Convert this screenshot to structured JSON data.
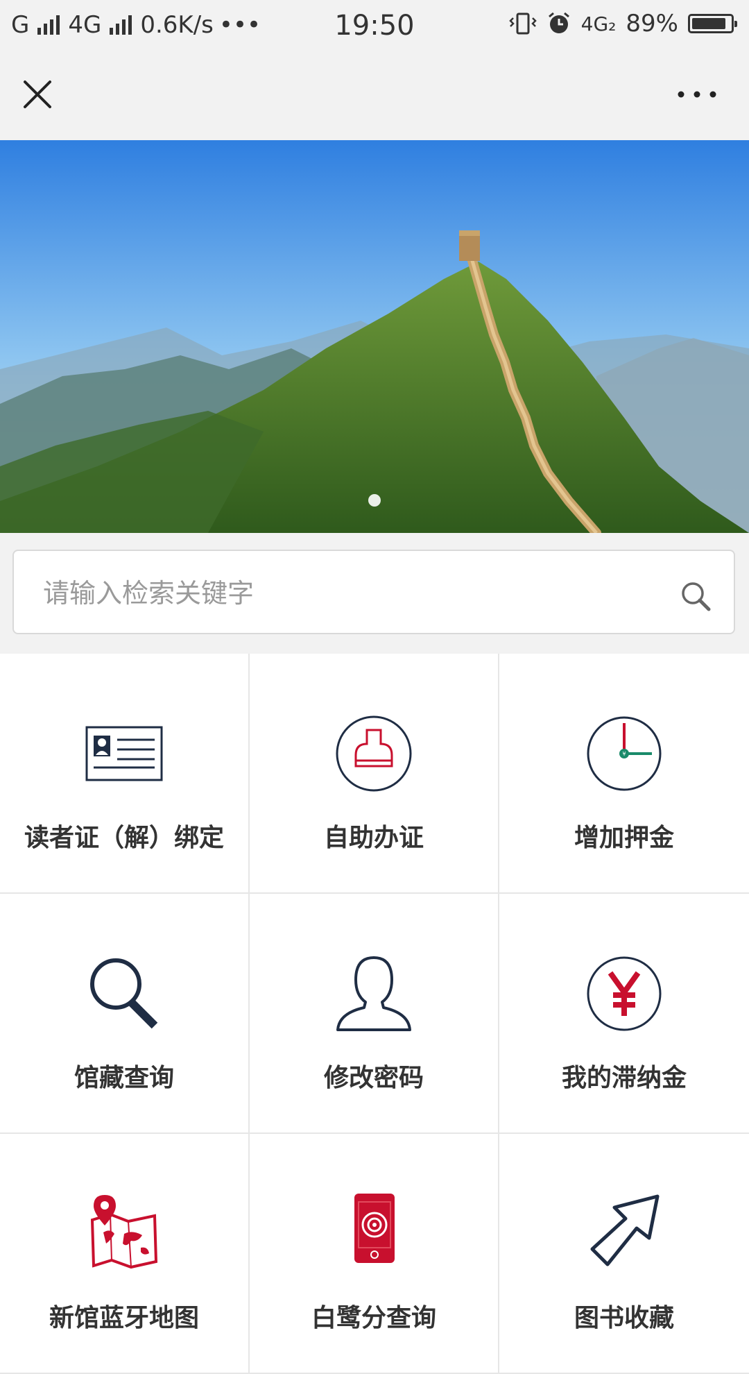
{
  "status_bar": {
    "carrier1": "G",
    "carrier2": "4G",
    "speed": "0.6K/s",
    "dots": "•••",
    "time": "19:50",
    "net_badge": "4G₂",
    "battery_percent": "89%",
    "battery_level": 0.89
  },
  "nav": {
    "close_icon": "close-icon",
    "more_icon": "more-icon"
  },
  "banner": {
    "image": "great-wall-photo",
    "slide_count": 1,
    "active_slide": 1
  },
  "search": {
    "placeholder": "请输入检索关键字",
    "value": ""
  },
  "grid": {
    "items": [
      {
        "label": "读者证（解）绑定",
        "icon": "reader-card-icon"
      },
      {
        "label": "自助办证",
        "icon": "self-service-card-icon"
      },
      {
        "label": "增加押金",
        "icon": "deposit-clock-icon"
      },
      {
        "label": "馆藏查询",
        "icon": "magnifier-icon"
      },
      {
        "label": "修改密码",
        "icon": "user-icon"
      },
      {
        "label": "我的滞纳金",
        "icon": "yen-icon"
      },
      {
        "label": "新馆蓝牙地图",
        "icon": "map-pin-icon"
      },
      {
        "label": "白鹭分查询",
        "icon": "phone-target-icon"
      },
      {
        "label": "图书收藏",
        "icon": "paper-plane-icon"
      }
    ]
  },
  "colors": {
    "navy": "#1f2d44",
    "red": "#c8102e",
    "teal": "#1a8a6a",
    "background": "#f2f2f2"
  }
}
